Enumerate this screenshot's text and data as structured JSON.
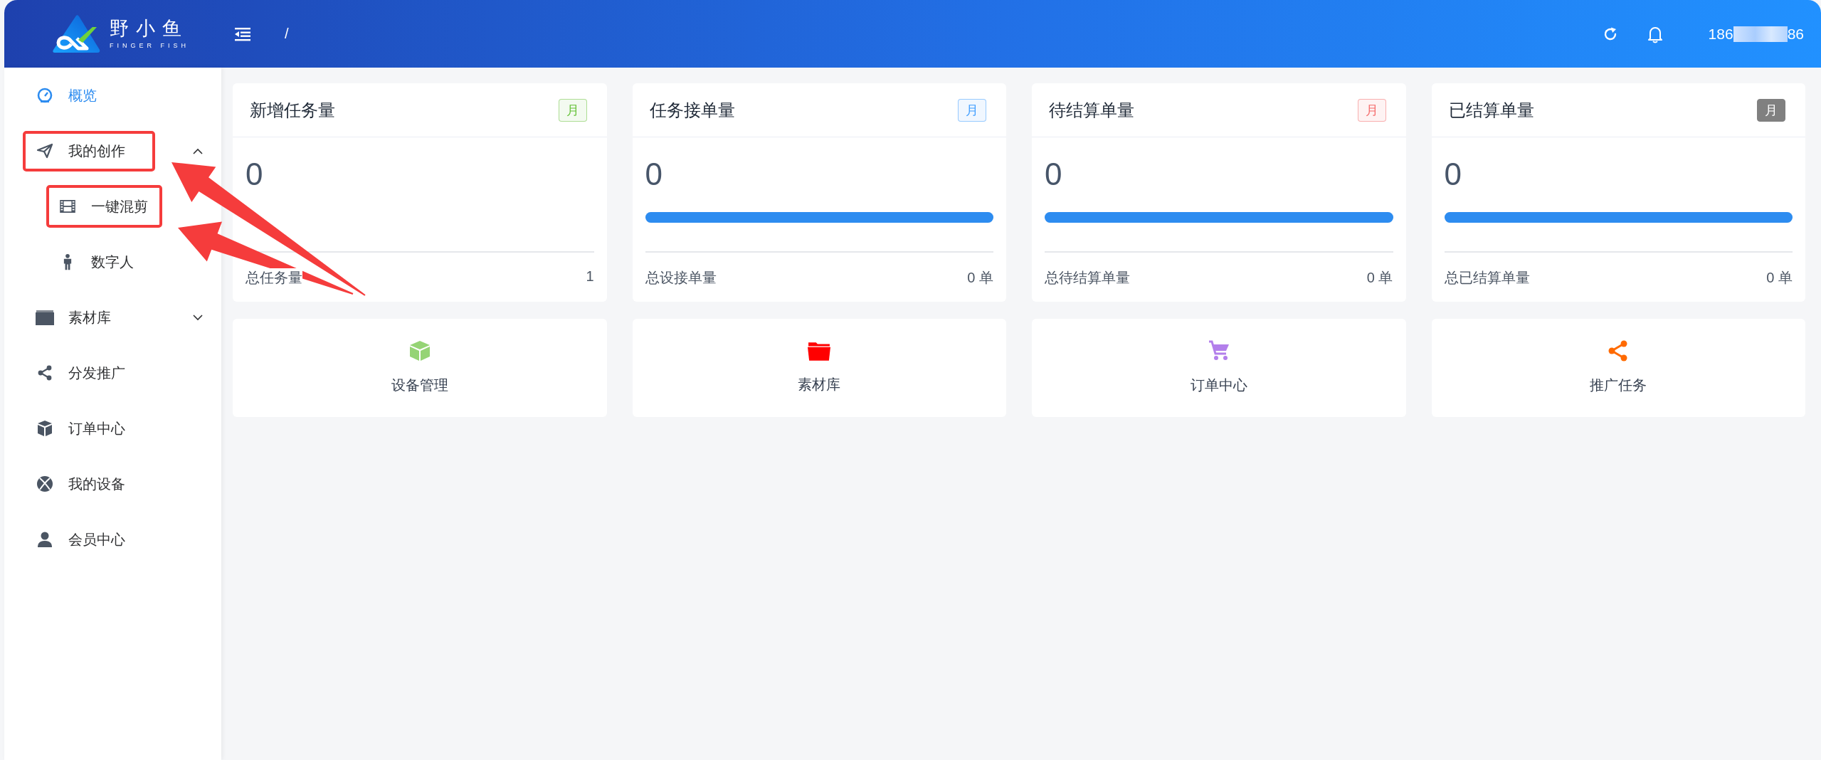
{
  "header": {
    "logo": {
      "title": "野小鱼",
      "subtitle": "FINGER FISH"
    },
    "breadcrumb": "/",
    "user": {
      "phone_start": "186",
      "phone_end": "86"
    }
  },
  "menu": [
    {
      "label": "概览",
      "selected": true,
      "highlighted": false
    },
    {
      "label": "我的创作",
      "selected": false,
      "highlighted": true,
      "expanded": true,
      "children": [
        {
          "label": "一键混剪",
          "selected": false,
          "highlighted": true
        },
        {
          "label": "数字人",
          "selected": false,
          "highlighted": false
        }
      ]
    },
    {
      "label": "素材库",
      "selected": false,
      "highlighted": false,
      "expanded": false
    },
    {
      "label": "分发推广",
      "selected": false,
      "highlighted": false
    },
    {
      "label": "订单中心",
      "selected": false,
      "highlighted": false
    },
    {
      "label": "我的设备",
      "selected": false,
      "highlighted": false
    },
    {
      "label": "会员中心",
      "selected": false,
      "highlighted": false
    }
  ],
  "stat_cards": [
    {
      "title": "新增任务量",
      "badge": {
        "label": "月",
        "color": "#67c23a",
        "filled": false
      },
      "value": "0",
      "footer_label": "总任务量",
      "footer_value": "1"
    },
    {
      "title": "任务接单量",
      "badge": {
        "label": "月",
        "color": "#409eff",
        "filled": false
      },
      "value": "0",
      "progress": {
        "level": 1
      },
      "footer_label": "总设接单量",
      "footer_value": "0 单"
    },
    {
      "title": "待结算单量",
      "badge": {
        "label": "月",
        "color": "#f56c6c",
        "filled": false
      },
      "value": "0",
      "progress": {
        "level": 1
      },
      "footer_label": "总待结算单量",
      "footer_value": "0 单"
    },
    {
      "title": "已结算单量",
      "badge": {
        "label": "月",
        "color": "#808080",
        "filled": true
      },
      "value": "0",
      "progress": {
        "level": 1
      },
      "footer_label": "总已结算单量",
      "footer_value": "0 单"
    }
  ],
  "quick_links": [
    {
      "label": "设备管理",
      "color": "#95d475"
    },
    {
      "label": "素材库",
      "color": "#ff0000"
    },
    {
      "label": "订单中心",
      "color": "#b37feb"
    },
    {
      "label": "推广任务",
      "color": "#ff6a00"
    }
  ],
  "annotation_arrows": [
    {
      "kind": "arrow"
    },
    {
      "kind": "arrow"
    }
  ]
}
